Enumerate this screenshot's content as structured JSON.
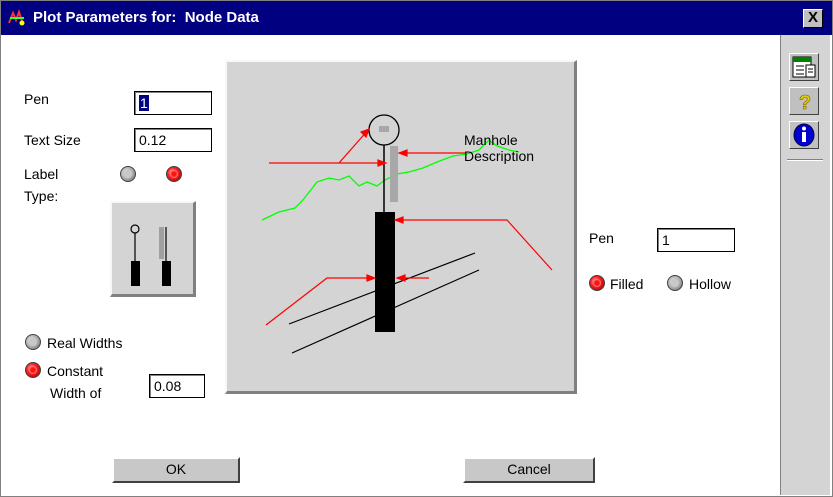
{
  "window": {
    "title": "Plot Parameters for:  Node Data",
    "close_label": "X"
  },
  "left": {
    "pen_label": "Pen",
    "pen_value": "1",
    "text_size_label": "Text Size",
    "text_size_value": "0.12",
    "label_label_line1": "Label",
    "label_label_line2": "Type:"
  },
  "widths": {
    "real_label": "Real Widths",
    "constant_label_line1": "Constant",
    "constant_label_line2": "Width of",
    "constant_value": "0.08"
  },
  "preview": {
    "annotation_line1": "Manhole",
    "annotation_line2": "Description"
  },
  "right": {
    "pen_label": "Pen",
    "pen_value": "1",
    "filled_label": "Filled",
    "hollow_label": "Hollow"
  },
  "buttons": {
    "ok": "OK",
    "cancel": "Cancel"
  },
  "toolbar": {
    "icons": [
      "document-icon",
      "help-icon",
      "info-icon"
    ]
  },
  "colors": {
    "titlebar": "#000080",
    "red_lines": "#ff0000",
    "ground_line": "#00ff00"
  }
}
